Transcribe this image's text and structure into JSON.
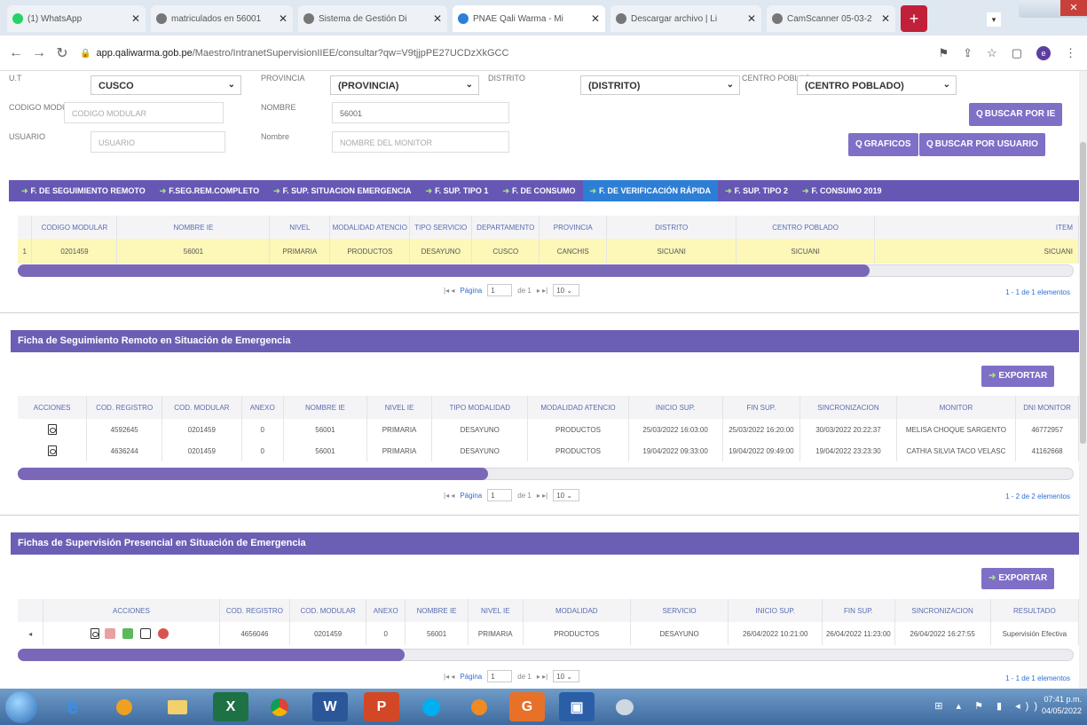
{
  "browser": {
    "tabs": [
      {
        "title": "(1) WhatsApp",
        "fav": "#25d366"
      },
      {
        "title": "matriculados en 56001",
        "fav": "#888888"
      },
      {
        "title": "Sistema de Gestión Di",
        "fav": "#888888"
      },
      {
        "title": "PNAE Qali Warma - Mi",
        "fav": "#2d7fd6"
      },
      {
        "title": "Descargar archivo | Li",
        "fav": "#888888"
      },
      {
        "title": "CamScanner 05-03-2",
        "fav": "#888888"
      }
    ],
    "url_host": "app.qaliwarma.gob.pe",
    "url_path": "/Maestro/IntranetSupervisionIIEE/consultar?qw=V9tjjpPE27UCDzXkGCC",
    "profile_initial": "e"
  },
  "filters": {
    "ut_label": "U.T",
    "ut_value": "CUSCO",
    "provincia_label": "PROVINCIA",
    "provincia_value": "(PROVINCIA)",
    "distrito_label": "DISTRITO",
    "distrito_value": "(DISTRITO)",
    "centro_label": "CENTRO POBLAC",
    "centro_value": "(CENTRO POBLADO)",
    "codigo_label": "CODIGO MODUL",
    "codigo_placeholder": "CODIGO MODULAR",
    "nombre_label": "NOMBRE",
    "nombre_value": "56001",
    "usuario_label": "USUARIO",
    "usuario_placeholder": "USUARIO",
    "nombre_monitor_label": "Nombre",
    "nombre_monitor_placeholder": "NOMBRE DEL MONITOR",
    "buscar_ie_label": "BUSCAR POR IE",
    "graficos_label": "GRAFICOS",
    "buscar_usuario_label": "BUSCAR POR USUARIO"
  },
  "page_tabs": [
    {
      "label": "F. DE SEGUIMIENTO REMOTO"
    },
    {
      "label": "F.SEG.REM.COMPLETO"
    },
    {
      "label": "F. SUP. SITUACION EMERGENCIA"
    },
    {
      "label": "F. SUP. TIPO 1"
    },
    {
      "label": "F. DE CONSUMO"
    },
    {
      "label": "F. DE VERIFICACIÓN RÁPIDA"
    },
    {
      "label": "F. SUP. TIPO 2"
    },
    {
      "label": "F. CONSUMO 2019"
    }
  ],
  "ie_table": {
    "headers": [
      "CODIGO MODULAR",
      "NOMBRE IE",
      "NIVEL",
      "MODALIDAD ATENCIO",
      "TIPO SERVICIO",
      "DEPARTAMENTO",
      "PROVINCIA",
      "DISTRITO",
      "CENTRO POBLADO",
      "ITEM"
    ],
    "row_index": "1",
    "row": [
      "0201459",
      "56001",
      "PRIMARIA",
      "PRODUCTOS",
      "DESAYUNO",
      "CUSCO",
      "CANCHIS",
      "SICUANI",
      "SICUANI",
      "SICUANI"
    ],
    "pager_label": "Página",
    "pager_page": "1",
    "pager_of": "de 1",
    "pager_size": "10",
    "count": "1 - 1 de 1 elementos"
  },
  "remote": {
    "title": "Ficha de Seguimiento Remoto en Situación de Emergencia",
    "export_label": "EXPORTAR",
    "headers": [
      "ACCIONES",
      "COD. REGISTRO",
      "COD. MODULAR",
      "ANEXO",
      "NOMBRE IE",
      "NIVEL IE",
      "TIPO MODALIDAD",
      "MODALIDAD ATENCIO",
      "INICIO SUP.",
      "FIN SUP.",
      "SINCRONIZACION",
      "MONITOR",
      "DNI MONITOR"
    ],
    "rows": [
      [
        "4592645",
        "0201459",
        "0",
        "56001",
        "PRIMARIA",
        "DESAYUNO",
        "PRODUCTOS",
        "25/03/2022 16:03:00",
        "25/03/2022 16:20:00",
        "30/03/2022 20:22:37",
        "MELISA CHOQUE SARGENTO",
        "46772957"
      ],
      [
        "4636244",
        "0201459",
        "0",
        "56001",
        "PRIMARIA",
        "DESAYUNO",
        "PRODUCTOS",
        "19/04/2022 09:33:00",
        "19/04/2022 09:49:00",
        "19/04/2022 23:23:30",
        "CATHIA SILVIA TACO VELASC",
        "41162668"
      ]
    ],
    "pager_label": "Página",
    "pager_page": "1",
    "pager_of": "de 1",
    "pager_size": "10",
    "count": "1 - 2 de 2 elementos"
  },
  "presencial": {
    "title": "Fichas de Supervisión Presencial en Situación de Emergencia",
    "export_label": "EXPORTAR",
    "headers": [
      "ACCIONES",
      "COD. REGISTRO",
      "COD. MODULAR",
      "ANEXO",
      "NOMBRE IE",
      "NIVEL IE",
      "MODALIDAD",
      "SERVICIO",
      "INICIO SUP.",
      "FIN SUP.",
      "SINCRONIZACION",
      "RESULTADO"
    ],
    "row": [
      "4656046",
      "0201459",
      "0",
      "56001",
      "PRIMARIA",
      "PRODUCTOS",
      "DESAYUNO",
      "26/04/2022 10:21:00",
      "26/04/2022 11:23:00",
      "26/04/2022 16:27:55",
      "Supervisión Efectiva"
    ],
    "pager_label": "Página",
    "pager_page": "1",
    "pager_of": "de 1",
    "pager_size": "10",
    "count": "1 - 1 de 1 elementos"
  },
  "taskbar": {
    "time": "07:41 p.m.",
    "date": "04/05/2022"
  },
  "colors": {
    "accent": "#6657b5",
    "active_tab": "#2d7fd6",
    "highlight_row": "#fdf7b8"
  }
}
